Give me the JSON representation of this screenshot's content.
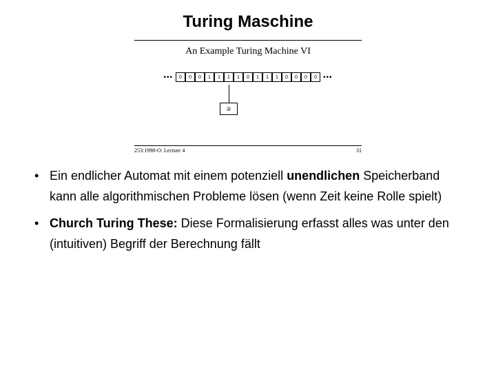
{
  "title": "Turing Maschine",
  "figure": {
    "caption": "An Example Turing Machine VI",
    "dots": "•••",
    "tape": [
      "0",
      "0",
      "0",
      "1",
      "1",
      "1",
      "1",
      "0",
      "1",
      "1",
      "1",
      "0",
      "0",
      "0",
      "0"
    ],
    "head_state": "②",
    "footer_left": "253:1998-O: Lecture 4",
    "footer_right": "31"
  },
  "bullets": {
    "b1_p1": "Ein endlicher Automat mit einem potenziell ",
    "b1_bold": "unendlichen",
    "b1_p2": " Speicherband kann alle algorithmischen Probleme lösen (wenn Zeit keine Rolle spielt)",
    "b2_bold": "Church Turing These:",
    "b2_rest": " Diese Formalisierung erfasst alles was unter den (intuitiven) Begriff der Berechnung fällt"
  }
}
